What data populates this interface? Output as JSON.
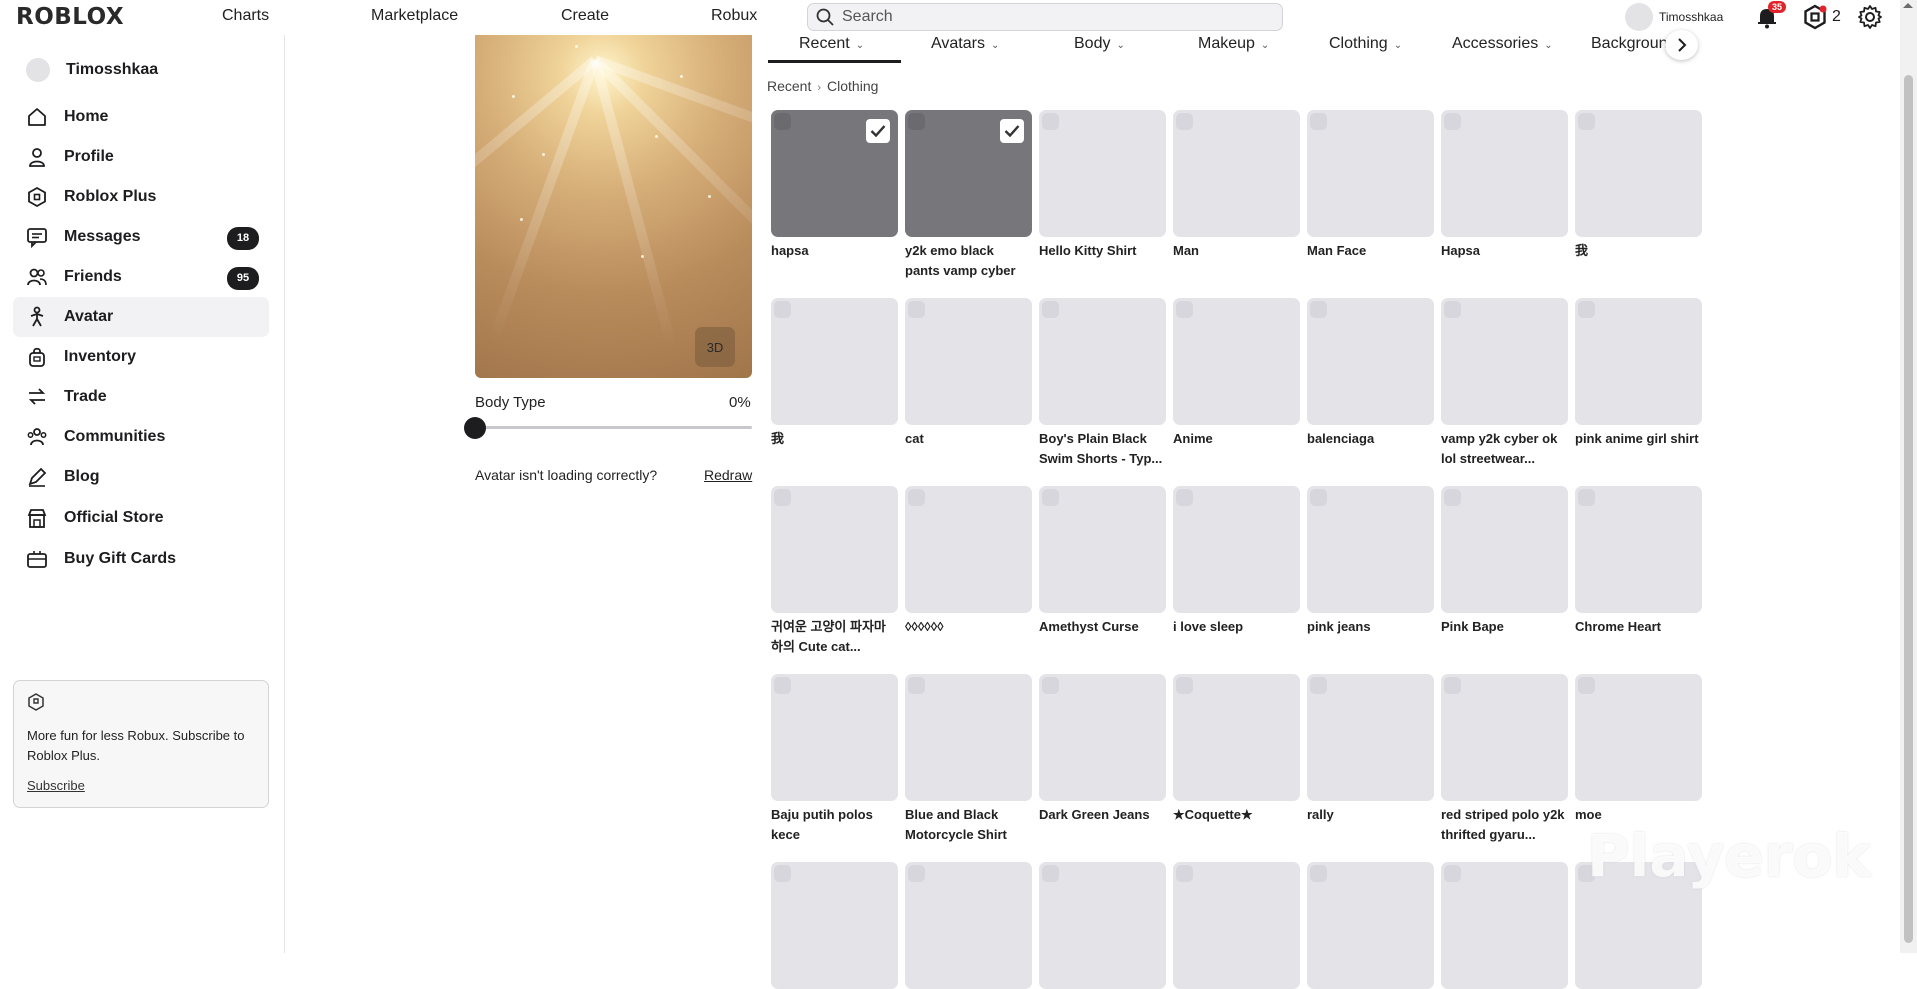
{
  "header": {
    "logo": "ROBLOX",
    "nav": [
      "Charts",
      "Marketplace",
      "Create",
      "Robux"
    ],
    "search_placeholder": "Search",
    "username": "Timosshkaa",
    "notification_count": "35",
    "robux_balance": "2"
  },
  "sidebar": {
    "username": "Timosshkaa",
    "items": [
      {
        "label": "Home",
        "icon": "home-icon"
      },
      {
        "label": "Profile",
        "icon": "profile-icon"
      },
      {
        "label": "Roblox Plus",
        "icon": "roblox-plus-icon"
      },
      {
        "label": "Messages",
        "icon": "messages-icon",
        "count": "18"
      },
      {
        "label": "Friends",
        "icon": "friends-icon",
        "count": "95"
      },
      {
        "label": "Avatar",
        "icon": "avatar-icon",
        "active": true
      },
      {
        "label": "Inventory",
        "icon": "inventory-icon"
      },
      {
        "label": "Trade",
        "icon": "trade-icon"
      },
      {
        "label": "Communities",
        "icon": "communities-icon"
      },
      {
        "label": "Blog",
        "icon": "blog-icon"
      },
      {
        "label": "Official Store",
        "icon": "store-icon"
      },
      {
        "label": "Buy Gift Cards",
        "icon": "gift-card-icon"
      }
    ],
    "promo": {
      "text": "More fun for less Robux. Subscribe to Roblox Plus.",
      "link": "Subscribe"
    }
  },
  "preview": {
    "toggle_label": "3D",
    "body_type_label": "Body Type",
    "body_type_value": "0%",
    "body_type_fraction": 0,
    "loading_text": "Avatar isn't loading correctly?",
    "redraw_label": "Redraw"
  },
  "tabs": [
    {
      "label": "Recent",
      "active": true
    },
    {
      "label": "Avatars"
    },
    {
      "label": "Body"
    },
    {
      "label": "Makeup"
    },
    {
      "label": "Clothing"
    },
    {
      "label": "Accessories"
    },
    {
      "label": "Backgroun"
    }
  ],
  "breadcrumb": [
    "Recent",
    "Clothing"
  ],
  "items": [
    [
      {
        "name": "hapsa",
        "selected": true
      },
      {
        "name": "y2k emo black pants vamp cyber",
        "selected": true
      },
      {
        "name": "Hello Kitty Shirt"
      },
      {
        "name": "Man"
      },
      {
        "name": "Man Face"
      },
      {
        "name": "Hapsa"
      },
      {
        "name": "我"
      }
    ],
    [
      {
        "name": "我"
      },
      {
        "name": "cat"
      },
      {
        "name": "Boy's Plain Black Swim Shorts - Typ..."
      },
      {
        "name": "Anime"
      },
      {
        "name": "balenciaga"
      },
      {
        "name": "vamp y2k cyber ok lol streetwear..."
      },
      {
        "name": "pink anime girl shirt"
      }
    ],
    [
      {
        "name": "귀여운 고양이 파자마 하의 Cute cat..."
      },
      {
        "name": "◊◊◊◊◊◊"
      },
      {
        "name": "Amethyst Curse"
      },
      {
        "name": "i love sleep"
      },
      {
        "name": "pink jeans"
      },
      {
        "name": "Pink Bape"
      },
      {
        "name": "Chrome Heart"
      }
    ],
    [
      {
        "name": "Baju putih polos kece"
      },
      {
        "name": "Blue and Black Motorcycle Shirt"
      },
      {
        "name": "Dark Green Jeans"
      },
      {
        "name": "★Coquette★"
      },
      {
        "name": "rally"
      },
      {
        "name": "red striped polo y2k thrifted gyaru..."
      },
      {
        "name": "moe"
      }
    ],
    [
      {
        "name": ""
      },
      {
        "name": ""
      },
      {
        "name": ""
      },
      {
        "name": ""
      },
      {
        "name": ""
      },
      {
        "name": ""
      },
      {
        "name": ""
      }
    ]
  ],
  "watermark": "Playerok",
  "colors": {
    "accent": "#1d1d1f",
    "badge": "#e0242a",
    "tile": "#e3e3e8",
    "tile_selected": "#76767b"
  }
}
